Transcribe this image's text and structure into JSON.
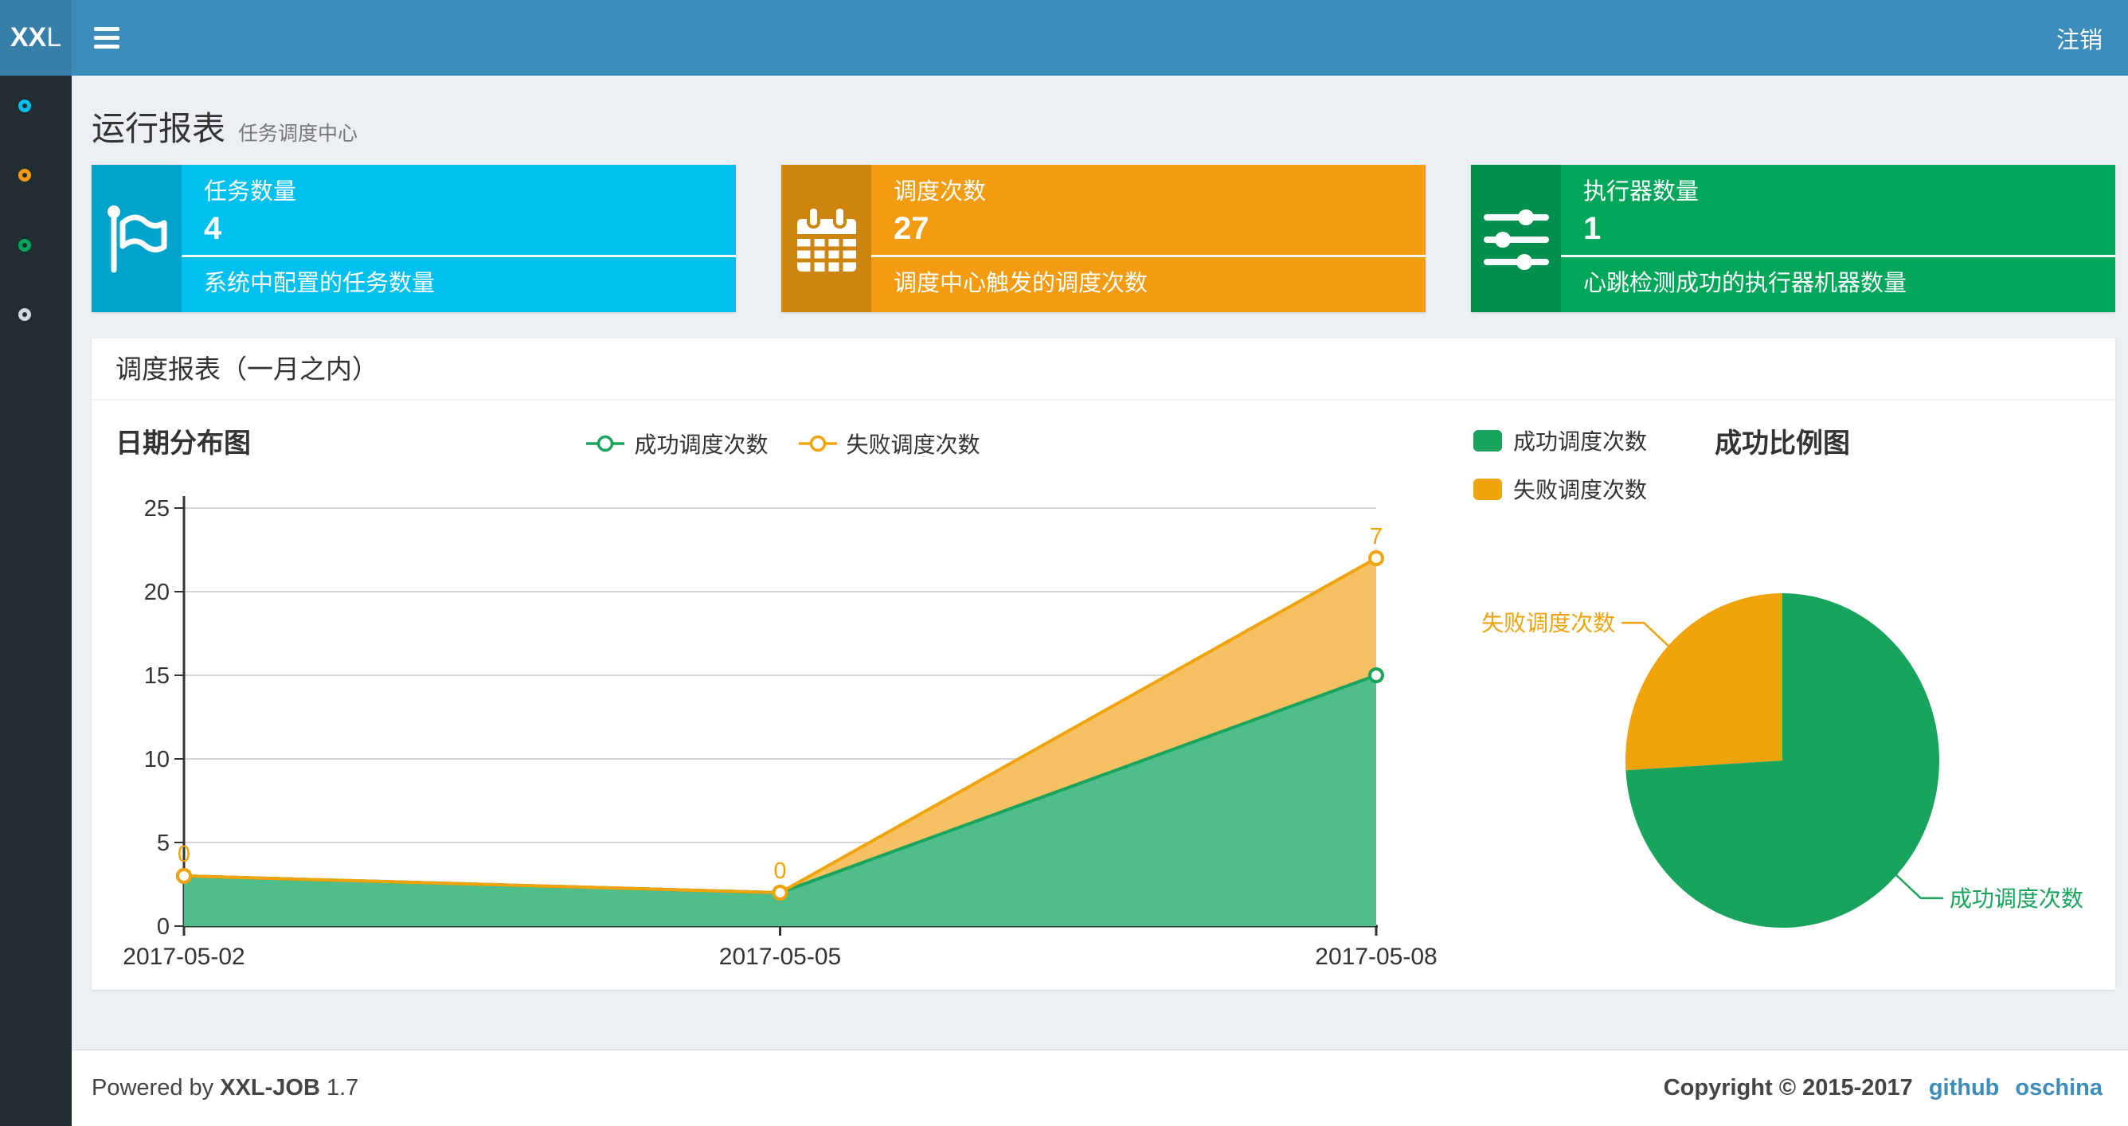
{
  "header": {
    "logo_bold": "XX",
    "logo_light": "L",
    "logout_label": "注销"
  },
  "sidebar": {
    "items": [
      {
        "name": "menu-report",
        "color": "#00c0ef"
      },
      {
        "name": "menu-jobs",
        "color": "#f39c12"
      },
      {
        "name": "menu-executors",
        "color": "#00a65a"
      },
      {
        "name": "menu-help",
        "color": "#d2d6de"
      }
    ]
  },
  "page": {
    "title": "运行报表",
    "subtitle": "任务调度中心"
  },
  "stats": [
    {
      "title": "任务数量",
      "value": "4",
      "desc": "系统中配置的任务数量",
      "color": "#00c0ef",
      "icon_bg": "#00a3cb",
      "icon": "flag-icon"
    },
    {
      "title": "调度次数",
      "value": "27",
      "desc": "调度中心触发的调度次数",
      "color": "#f39c12",
      "icon_bg": "#cd850e",
      "icon": "calendar-icon"
    },
    {
      "title": "执行器数量",
      "value": "1",
      "desc": "心跳检测成功的执行器机器数量",
      "color": "#00a65a",
      "icon_bg": "#00904e",
      "icon": "sliders-icon"
    }
  ],
  "panel": {
    "title": "调度报表（一月之内）"
  },
  "chart_data": [
    {
      "type": "area",
      "title": "日期分布图",
      "categories": [
        "2017-05-02",
        "2017-05-05",
        "2017-05-08"
      ],
      "series": [
        {
          "name": "成功调度次数",
          "values": [
            3,
            2,
            15
          ],
          "color": "#18a45c",
          "fill": "#4fbe8b"
        },
        {
          "name": "失败调度次数",
          "values": [
            0,
            0,
            7
          ],
          "color": "#f0a30a",
          "fill": "#f6c163",
          "point_labels": [
            "0",
            "0",
            "7"
          ]
        }
      ],
      "stacked": true,
      "ylim": [
        0,
        25
      ],
      "ytick": 5,
      "grid": true,
      "legend_position": "top-center"
    },
    {
      "type": "pie",
      "title": "成功比例图",
      "slices": [
        {
          "name": "成功调度次数",
          "value": 20,
          "color": "#18a45c"
        },
        {
          "name": "失败调度次数",
          "value": 7,
          "color": "#f0a30a"
        }
      ],
      "legend_position": "top-left"
    }
  ],
  "footer": {
    "powered_prefix": "Powered by",
    "brand": "XXL-JOB",
    "version": "1.7",
    "copyright": "Copyright © 2015-2017",
    "links": [
      {
        "label": "github"
      },
      {
        "label": "oschina"
      }
    ]
  },
  "colors": {
    "navbar": "#3c8dbc",
    "logo_bg": "#367fa9",
    "sidebar_bg": "#222d32",
    "content_bg": "#ecf0f5",
    "link": "#3c8dbc",
    "axis": "#333333",
    "gridline": "#d6d6d6"
  }
}
